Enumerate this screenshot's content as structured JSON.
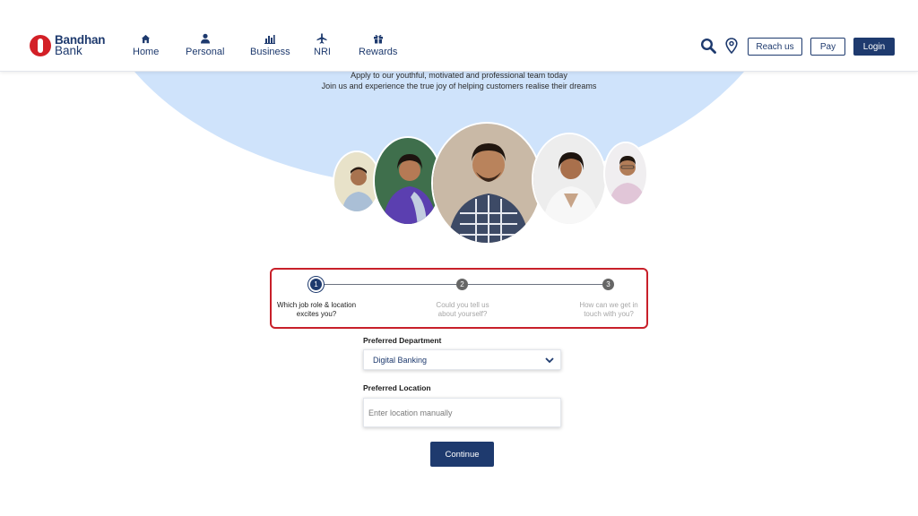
{
  "brand": {
    "name_line1": "Bandhan",
    "name_line2": "Bank",
    "color": "#d32027",
    "navy": "#1e3a6e"
  },
  "nav": [
    {
      "label": "Home",
      "icon": "home-icon"
    },
    {
      "label": "Personal",
      "icon": "person-icon"
    },
    {
      "label": "Business",
      "icon": "bar-chart-icon"
    },
    {
      "label": "NRI",
      "icon": "airplane-icon"
    },
    {
      "label": "Rewards",
      "icon": "gift-icon"
    }
  ],
  "header_actions": {
    "search_icon": "search-icon",
    "location_icon": "location-pin-icon",
    "reach_us": "Reach us",
    "pay": "Pay",
    "login": "Login"
  },
  "hero": {
    "line1": "Apply to our youthful, motivated and professional team today",
    "line2": "Join us and experience the true joy of helping customers realise their dreams",
    "bg_color": "#cfe3fb"
  },
  "stepper": {
    "steps": [
      {
        "number": "1",
        "label_line1": "Which job role & location",
        "label_line2": "excites you?",
        "active": true
      },
      {
        "number": "2",
        "label_line1": "Could you tell us",
        "label_line2": "about yourself?",
        "active": false
      },
      {
        "number": "3",
        "label_line1": "How can we get in",
        "label_line2": "touch with you?",
        "active": false
      }
    ],
    "highlight_color": "#c8202a"
  },
  "form": {
    "department_label": "Preferred Department",
    "department_value": "Digital Banking",
    "location_label": "Preferred Location",
    "location_placeholder": "Enter location manually",
    "continue_label": "Continue"
  }
}
